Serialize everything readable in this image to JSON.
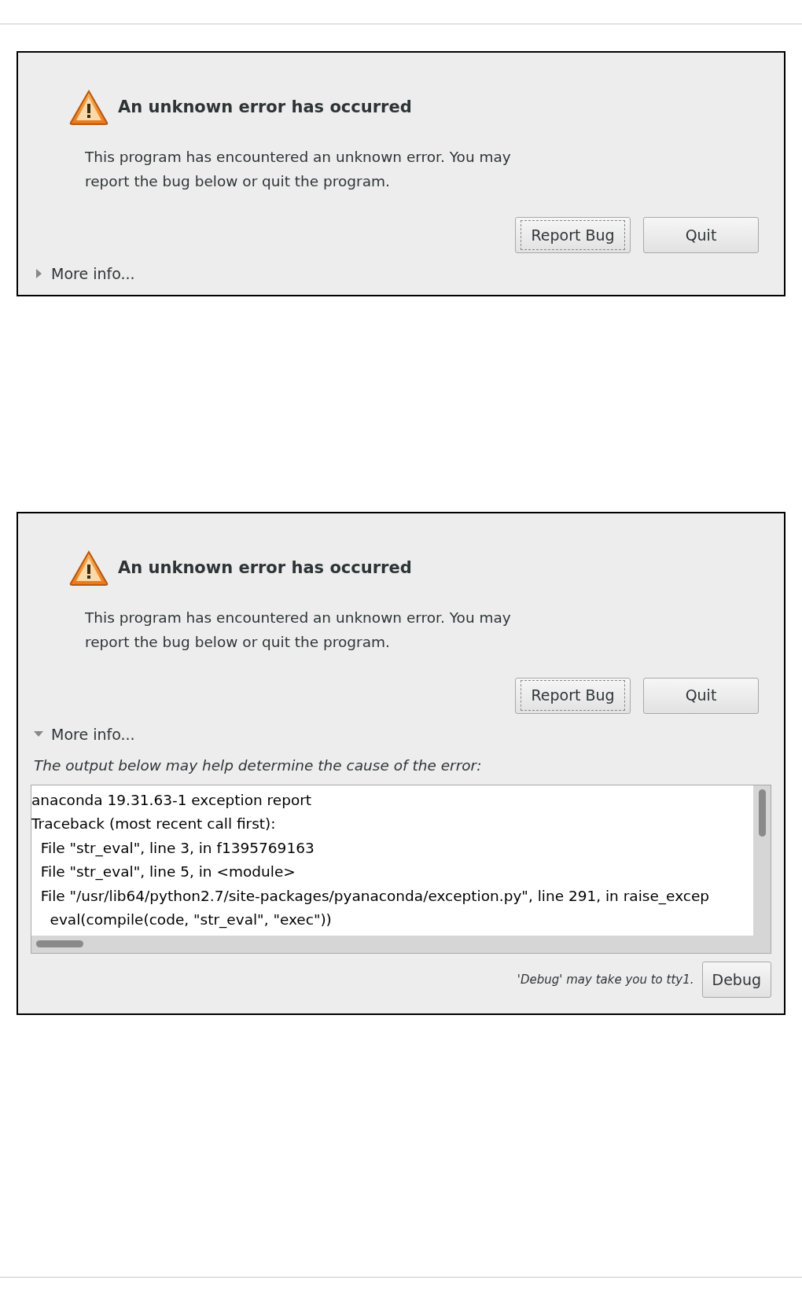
{
  "dialogs": [
    {
      "title": "An unknown error has occurred",
      "message": "This program has encountered an unknown error. You may report the bug below or quit the program.",
      "buttons": [
        {
          "label": "Report Bug",
          "focused": true
        },
        {
          "label": "Quit",
          "focused": false
        }
      ],
      "more_info": {
        "label": "More info...",
        "expanded": false
      }
    },
    {
      "title": "An unknown error has occurred",
      "message": "This program has encountered an unknown error. You may report the bug below or quit the program.",
      "buttons": [
        {
          "label": "Report Bug",
          "focused": true
        },
        {
          "label": "Quit",
          "focused": false
        }
      ],
      "more_info": {
        "label": "More info...",
        "expanded": true
      },
      "details": {
        "hint": "The output below may help determine the cause of the error:",
        "lines": [
          "anaconda 19.31.63-1 exception report",
          "Traceback (most recent call first):",
          "  File \"str_eval\", line 3, in f1395769163",
          "  File \"str_eval\", line 5, in <module>",
          "  File \"/usr/lib64/python2.7/site-packages/pyanaconda/exception.py\", line 291, in raise_excep",
          "    eval(compile(code, \"str_eval\", \"exec\"))"
        ],
        "debug_note": "'Debug' may take you to tty1.",
        "debug_button": "Debug"
      }
    }
  ]
}
